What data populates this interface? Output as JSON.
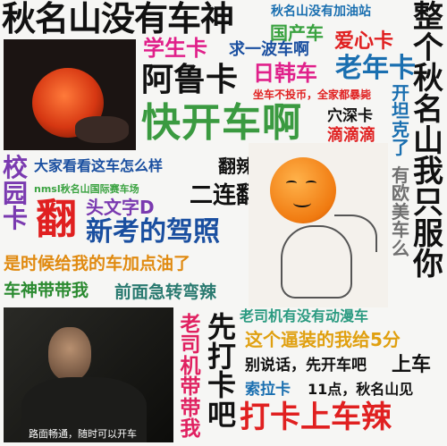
{
  "collage": {
    "title": "秋名山没有车神",
    "top_right": "秋名山没有加油站",
    "vertical_right": "整个秋名山我只服你",
    "phrases": {
      "student_card": "学生卡",
      "guochanche": "国产车",
      "love_card": "爱心卡",
      "wait_bus": "求一波车啊",
      "aru_card": "阿鲁卡",
      "rihan": "日韩车",
      "elder_card": "老年卡",
      "no_coin": "坐车不投币，全家都暴毙",
      "kuaikaiche": "快开车啊",
      "xueshen_card": "穴深卡",
      "didi": "滴滴滴",
      "kaitanke": "开坦克了",
      "you_oumei": "有欧美车么",
      "xiaoyuan_card": "校园卡",
      "everyone_look": "大家看看这车怎么样",
      "fanla": "翻辣",
      "nmsl": "nmsl秋名山国际赛车场",
      "erlian_fan": "二连翻",
      "fan": "翻",
      "touwenzi": "头文字D",
      "new_license": "新考的驾照",
      "add_oil": "是时候给我的车加点油了",
      "chesheng": "车神带带我",
      "qianmian": "前面急转弯辣",
      "old_driver_anime": "老司机有没有动漫车",
      "old_driver_vertical": "老司机带带我",
      "daka_first": "先打卡吧",
      "give_5": "这个逼装的我给5分",
      "bieshuohua": "别说话，先开车吧",
      "shangche": "上车",
      "suola": "索拉卡",
      "eleven": "11点，秋名山见",
      "final": "打卡上车辣",
      "road_caption": "路面畅通，随时可以开车"
    }
  }
}
